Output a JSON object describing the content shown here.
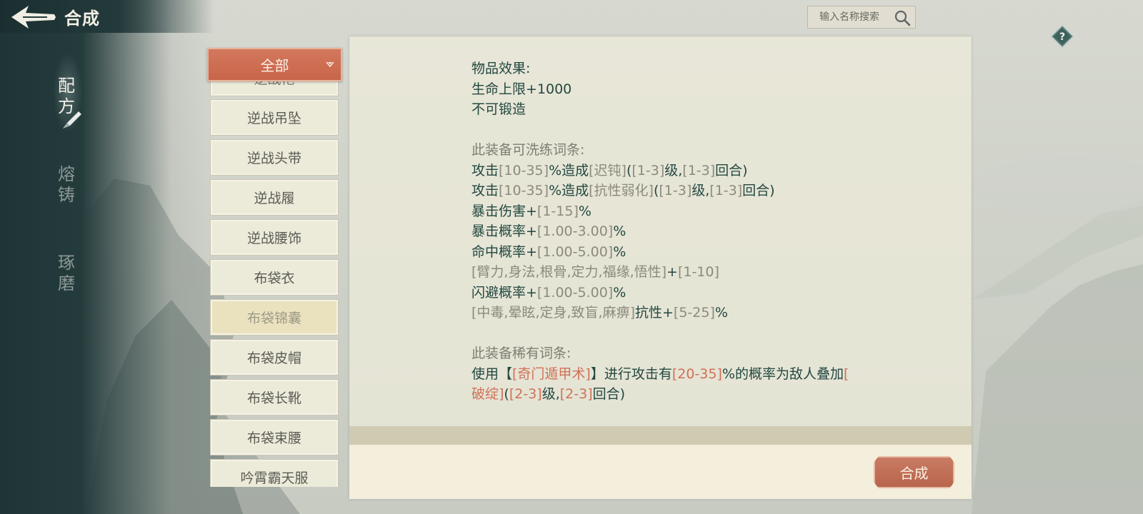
{
  "header": {
    "title": "合成",
    "back_icon": "back-arrow-icon"
  },
  "sidebar": {
    "tabs": [
      {
        "label": "配方",
        "active": true
      },
      {
        "label": "熔铸",
        "active": false
      },
      {
        "label": "琢磨",
        "active": false
      }
    ]
  },
  "search": {
    "placeholder": "输入名称搜索",
    "icon": "search-icon"
  },
  "filter": {
    "selected": "全部"
  },
  "recipes": {
    "partial_top": "逆战袍",
    "items": [
      {
        "label": "逆战吊坠",
        "selected": false
      },
      {
        "label": "逆战头带",
        "selected": false
      },
      {
        "label": "逆战履",
        "selected": false
      },
      {
        "label": "逆战腰饰",
        "selected": false
      },
      {
        "label": "布袋衣",
        "selected": false
      },
      {
        "label": "布袋锦囊",
        "selected": true
      },
      {
        "label": "布袋皮帽",
        "selected": false
      },
      {
        "label": "布袋长靴",
        "selected": false
      },
      {
        "label": "布袋束腰",
        "selected": false
      },
      {
        "label": "吟霄霸天服",
        "selected": false
      }
    ]
  },
  "detail": {
    "effect_title": "物品效果:",
    "effect_line1": "生命上限+1000",
    "effect_line2": "不可锻造",
    "refine_title": "此装备可洗练词条:",
    "refine": {
      "l1": {
        "a": "攻击",
        "b": "[10-35]",
        "c": "%造成",
        "d": "[迟钝]",
        "e": "(",
        "f": "[1-3]",
        "g": "级,",
        "h": "[1-3]",
        "i": "回合)"
      },
      "l2": {
        "a": "攻击",
        "b": "[10-35]",
        "c": "%造成",
        "d": "[抗性弱化]",
        "e": "(",
        "f": "[1-3]",
        "g": "级,",
        "h": "[1-3]",
        "i": "回合)"
      },
      "l3": {
        "a": "暴击伤害+",
        "b": "[1-15]",
        "c": "%"
      },
      "l4": {
        "a": "暴击概率+",
        "b": "[1.00-3.00]",
        "c": "%"
      },
      "l5": {
        "a": "命中概率+",
        "b": "[1.00-5.00]",
        "c": "%"
      },
      "l6": {
        "a": "[臂力,身法,根骨,定力,福缘,悟性]",
        "b": "+",
        "c": "[1-10]"
      },
      "l7": {
        "a": "闪避概率+",
        "b": "[1.00-5.00]",
        "c": "%"
      },
      "l8": {
        "a": "[中毒,晕眩,定身,致盲,麻痹]",
        "b": "抗性+",
        "c": "[5-25]",
        "d": "%"
      }
    },
    "rare_title": "此装备稀有词条:",
    "rare": {
      "a": "使用【",
      "b": "[奇门遁甲术]",
      "c": "】进行攻击有",
      "d": "[20-35]",
      "e": "%的概率为敌人叠加",
      "f": "[",
      "g": "破绽]",
      "h": "(",
      "i": "[2-3]",
      "j": "级,",
      "k": "[2-3]",
      "l": "回合)"
    }
  },
  "actions": {
    "synthesize_label": "合成"
  },
  "help": {
    "label": "?"
  },
  "colors": {
    "accent": "#c8654a",
    "highlight": "#d07157",
    "text_dark": "#234840",
    "text_dim": "#7e7d72"
  }
}
